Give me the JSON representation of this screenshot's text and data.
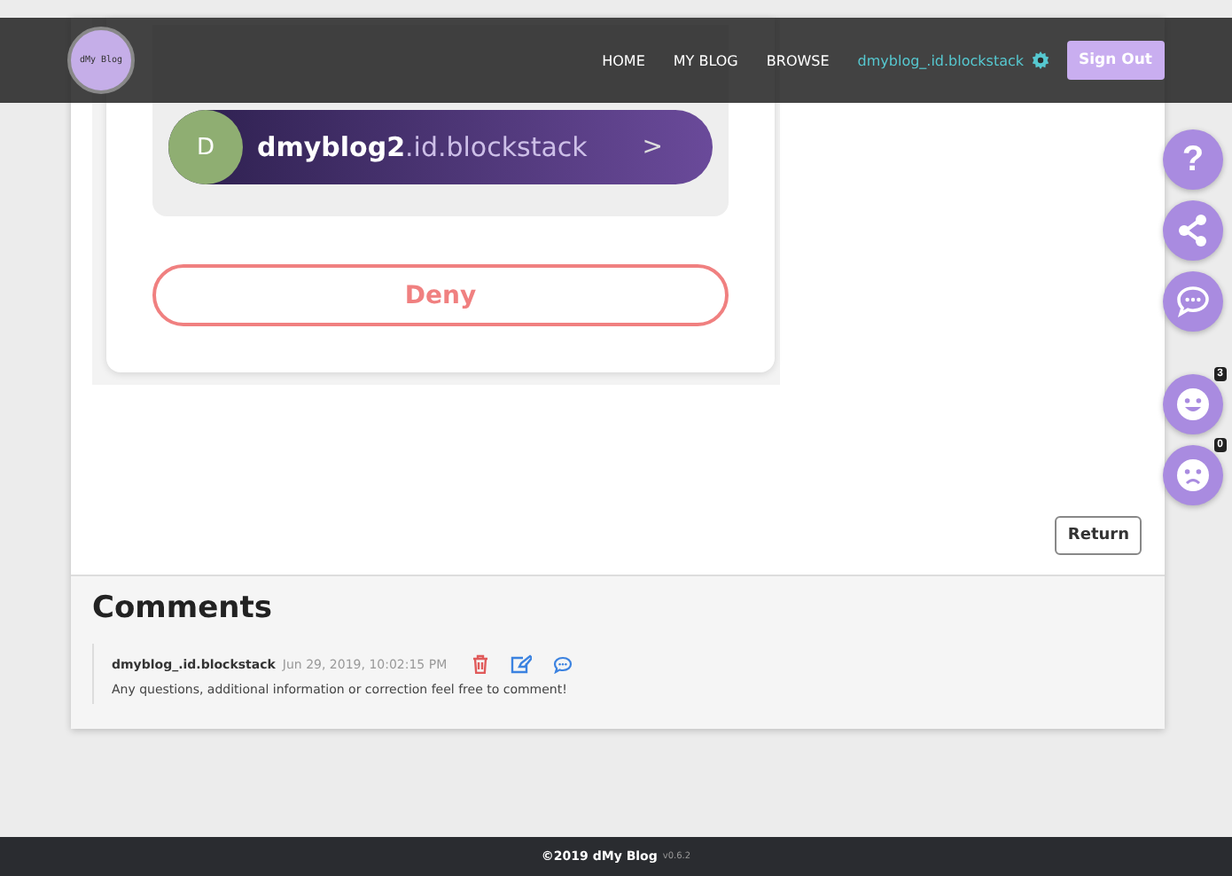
{
  "nav": {
    "logo": "dMy Blog",
    "links": [
      {
        "label": "HOME"
      },
      {
        "label": "MY BLOG"
      },
      {
        "label": "BROWSE"
      }
    ],
    "user": "dmyblog_.id.blockstack",
    "sign_out": "Sign Out"
  },
  "auth_card": {
    "account": {
      "initial": "D",
      "name": "dmyblog2",
      "suffix": ".id.blockstack",
      "chevron": ">"
    },
    "deny": "Deny"
  },
  "return_button": "Return",
  "fabs": [
    {
      "kind": "help",
      "label": "?"
    },
    {
      "kind": "share"
    },
    {
      "kind": "chat"
    },
    {
      "kind": "like",
      "badge": "3"
    },
    {
      "kind": "dislike",
      "badge": "0"
    }
  ],
  "comments": {
    "title": "Comments",
    "items": [
      {
        "author": "dmyblog_.id.blockstack",
        "date": "Jun 29, 2019, 10:02:15 PM",
        "text": "Any questions, additional information or correction feel free to comment!"
      }
    ]
  },
  "footer": {
    "copyright": "©2019 dMy Blog",
    "version": "v0.6.2"
  }
}
